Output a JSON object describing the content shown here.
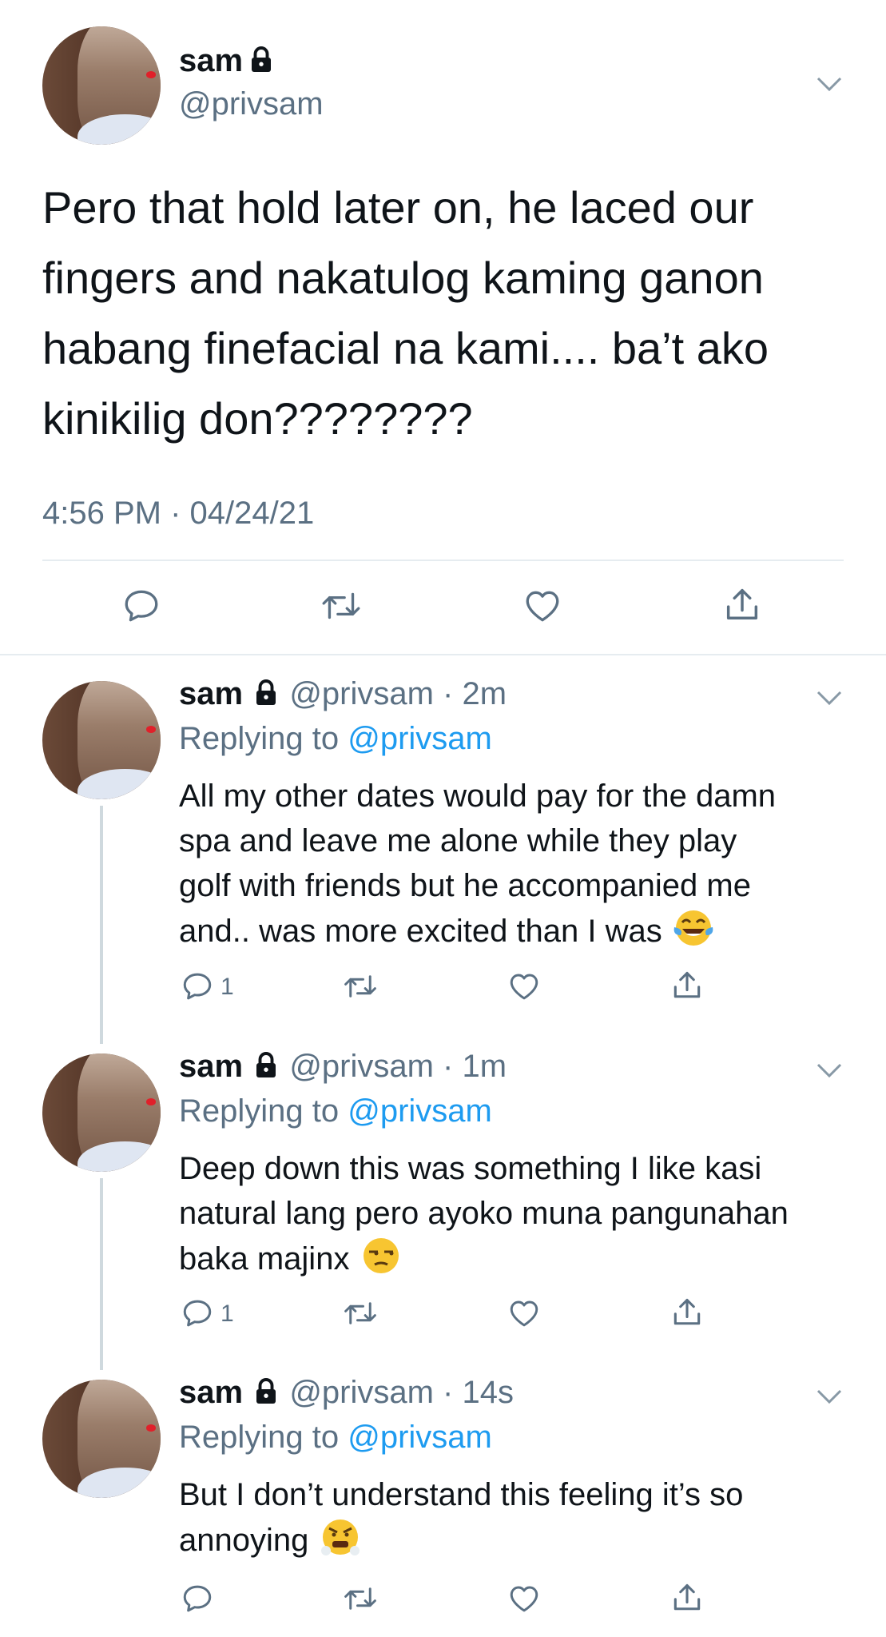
{
  "main_tweet": {
    "name": "sam",
    "handle": "@privsam",
    "text_lines": [
      "Pero that hold later on, he laced our",
      "fingers and nakatulog kaming ganon",
      "habang finefacial na kami.... ba’t ako",
      "kinikilig don????????"
    ],
    "timestamp": "4:56 PM · 04/24/21"
  },
  "replies": [
    {
      "name": "sam",
      "handle": "@privsam",
      "time": "2m",
      "replying_prefix": "Replying to ",
      "replying_to": "@privsam",
      "text_lines": [
        "All my other dates would pay for the damn",
        "spa and leave me alone while they play",
        "golf with friends but he accompanied me",
        "and.. was more excited than I was"
      ],
      "emoji": "face-with-tears-of-joy",
      "reply_count": "1"
    },
    {
      "name": "sam",
      "handle": "@privsam",
      "time": "1m",
      "replying_prefix": "Replying to ",
      "replying_to": "@privsam",
      "text_lines": [
        "Deep down this was something I like kasi",
        "natural lang pero ayoko muna pangunahan",
        "baka majinx"
      ],
      "emoji": "unamused-face",
      "reply_count": "1"
    },
    {
      "name": "sam",
      "handle": "@privsam",
      "time": "14s",
      "replying_prefix": "Replying to ",
      "replying_to": "@privsam",
      "text_lines": [
        "But I don’t understand this feeling it’s so",
        "annoying"
      ],
      "emoji": "face-with-steam-from-nose",
      "reply_count": ""
    }
  ],
  "separator": " · ",
  "icons": [
    "lock-icon",
    "chevron-down-icon",
    "reply-icon",
    "retweet-icon",
    "like-icon",
    "share-icon"
  ],
  "colors": {
    "accent": "#1d9bf0",
    "secondary_text": "#5b7083",
    "divider": "#e6ecf0"
  }
}
